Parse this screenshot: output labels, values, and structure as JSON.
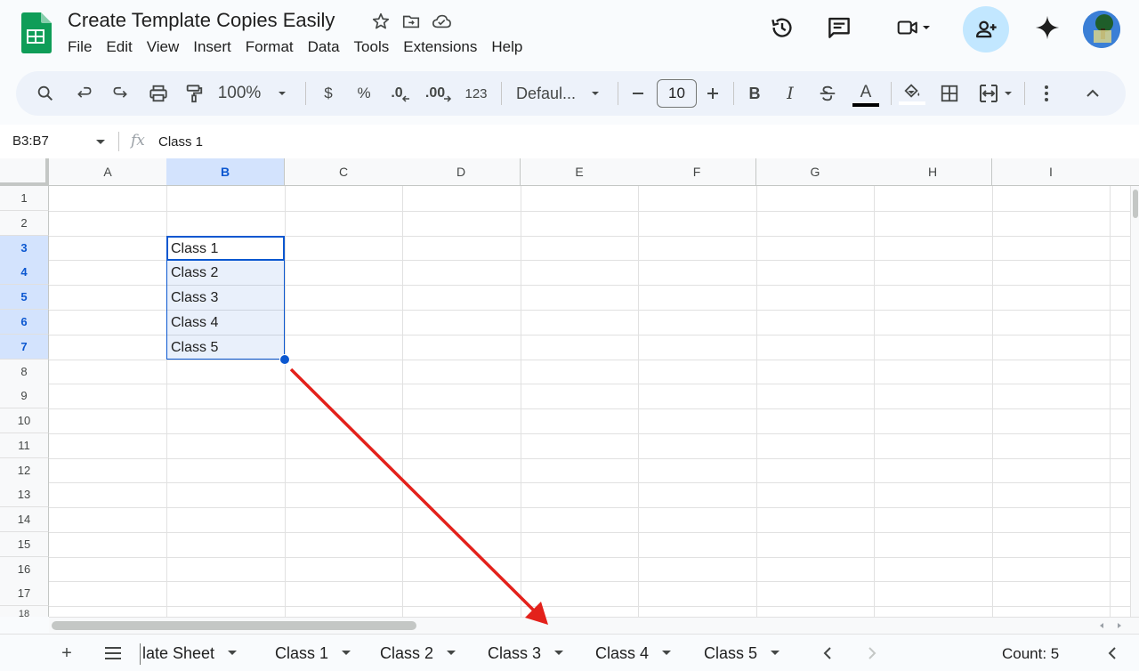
{
  "app": {
    "title": "Create Template Copies Easily",
    "menu": [
      "File",
      "Edit",
      "View",
      "Insert",
      "Format",
      "Data",
      "Tools",
      "Extensions",
      "Help"
    ]
  },
  "toolbar": {
    "zoom": "100%",
    "currency": "$",
    "percent": "%",
    "decrease_decimal": ".0",
    "increase_decimal": ".00",
    "number_format": "123",
    "font": "Defaul...",
    "font_size": "10",
    "bold": "B",
    "italic": "I",
    "text_color": "A"
  },
  "formula_bar": {
    "name_box": "B3:B7",
    "fx": "fx",
    "value": "Class 1"
  },
  "grid": {
    "columns": [
      "A",
      "B",
      "C",
      "D",
      "E",
      "F",
      "G",
      "H",
      "I"
    ],
    "selected_column": "B",
    "rows": [
      "1",
      "2",
      "3",
      "4",
      "5",
      "6",
      "7",
      "8",
      "9",
      "10",
      "11",
      "12",
      "13",
      "14",
      "15",
      "16",
      "17",
      "18"
    ],
    "selected_rows": [
      "3",
      "4",
      "5",
      "6",
      "7"
    ],
    "cells": [
      {
        "ref": "B3",
        "value": "Class 1"
      },
      {
        "ref": "B4",
        "value": "Class 2"
      },
      {
        "ref": "B5",
        "value": "Class 3"
      },
      {
        "ref": "B6",
        "value": "Class 4"
      },
      {
        "ref": "B7",
        "value": "Class 5"
      }
    ]
  },
  "sheets": {
    "add": "+",
    "tabs": [
      "late Sheet",
      "Class 1",
      "Class 2",
      "Class 3",
      "Class 4",
      "Class 5"
    ],
    "status": "Count: 5"
  },
  "colors": {
    "accent": "#0b57d0",
    "selection_fill": "#d3e3fd",
    "share_button": "#c2e7ff",
    "annotation_arrow": "#e3211b",
    "sheets_green": "#0f9d58"
  },
  "icons": [
    "search-icon",
    "undo-icon",
    "redo-icon",
    "print-icon",
    "paint-format-icon",
    "strikethrough-icon",
    "fill-color-icon",
    "borders-icon",
    "merge-icon",
    "more-icon",
    "collapse-icon",
    "star-icon",
    "move-icon",
    "cloud-icon",
    "history-icon",
    "comment-icon",
    "video-icon",
    "share-icon",
    "gemini-icon"
  ]
}
